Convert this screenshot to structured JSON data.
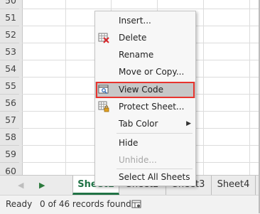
{
  "row_numbers": [
    "50",
    "51",
    "52",
    "53",
    "54",
    "55",
    "56",
    "57",
    "58",
    "59",
    "60",
    "61",
    "62"
  ],
  "context_menu": {
    "items": [
      {
        "label": "Insert...",
        "icon": "none",
        "disabled": false
      },
      {
        "label": "Delete",
        "icon": "delete-sheet-icon",
        "disabled": false
      },
      {
        "label": "Rename",
        "icon": "none",
        "disabled": false
      },
      {
        "label": "Move or Copy...",
        "icon": "none",
        "disabled": false
      },
      {
        "label": "View Code",
        "icon": "view-code-icon",
        "disabled": false,
        "highlighted": true
      },
      {
        "label": "Protect Sheet...",
        "icon": "protect-sheet-icon",
        "disabled": false
      },
      {
        "label": "Tab Color",
        "icon": "none",
        "disabled": false,
        "submenu": true
      },
      {
        "label": "Hide",
        "icon": "none",
        "disabled": false
      },
      {
        "label": "Unhide...",
        "icon": "none",
        "disabled": true
      },
      {
        "label": "Select All Sheets",
        "icon": "none",
        "disabled": false
      }
    ],
    "submenu_arrow": "▶"
  },
  "sheet_tabs": {
    "nav_left": "◀",
    "nav_right": "▶",
    "tabs": [
      "Sheet1",
      "Sheet2",
      "Sheet3",
      "Sheet4"
    ],
    "active_index": 0
  },
  "status_bar": {
    "ready": "Ready",
    "records": "0 of 46 records found",
    "icon": "macro-record-icon"
  },
  "colors": {
    "accent_green": "#217346",
    "highlight_red": "#e8342e"
  }
}
